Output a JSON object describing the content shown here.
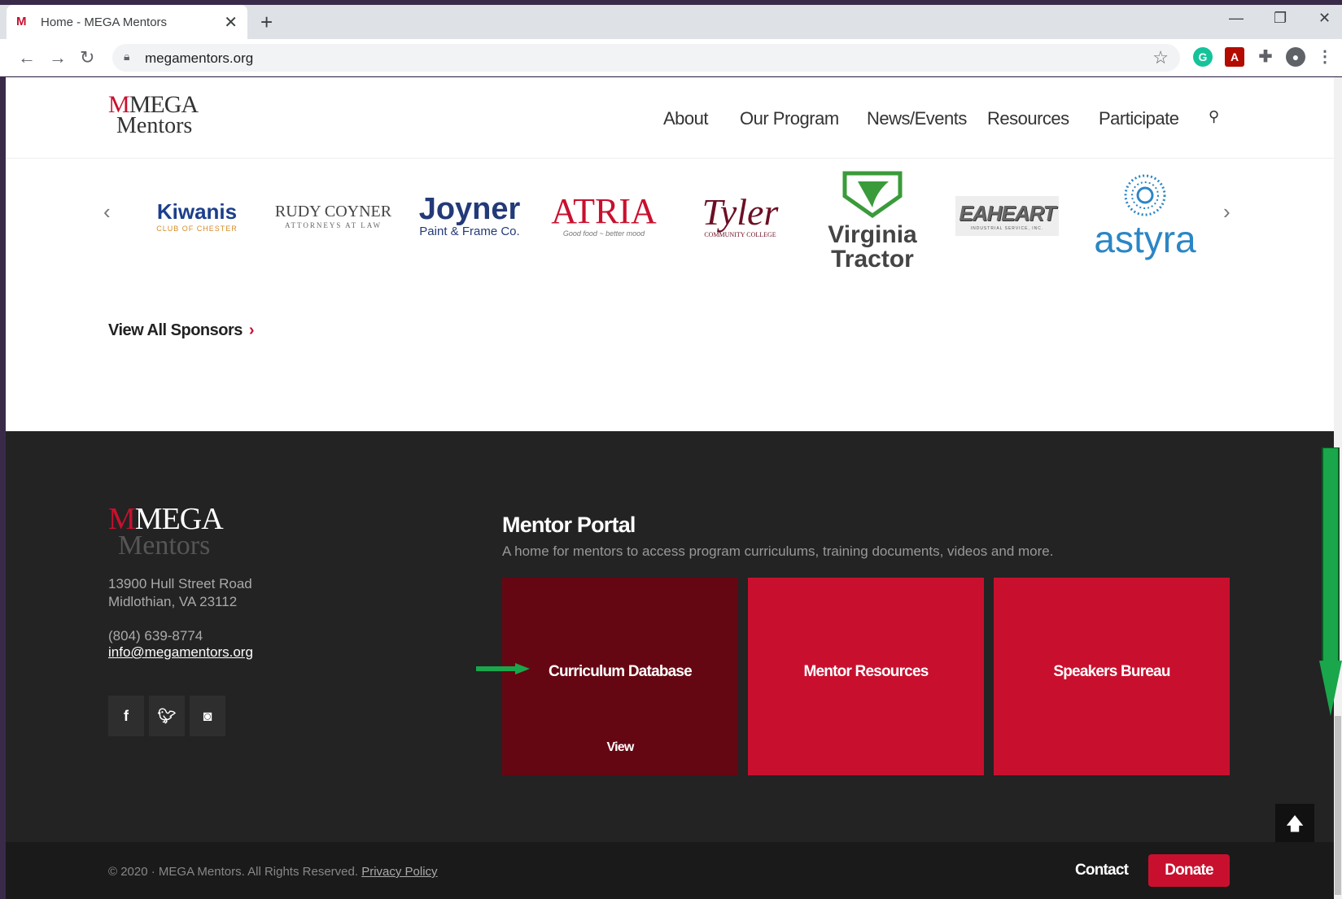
{
  "browser": {
    "tab_title": "Home - MEGA Mentors",
    "new_tab": "+",
    "url": "megamentors.org"
  },
  "header": {
    "logo_top": "MEGA",
    "logo_bottom": "Mentors",
    "nav": [
      "About",
      "Our Program",
      "News/Events",
      "Resources",
      "Participate"
    ]
  },
  "sponsors": {
    "items": [
      {
        "name": "Kiwanis",
        "sub": "CLUB OF CHESTER"
      },
      {
        "name": "RUDY COYNER",
        "sub": "ATTORNEYS AT LAW"
      },
      {
        "name": "Joyner",
        "sub": "Paint & Frame Co."
      },
      {
        "name": "ATRIA",
        "sub": "Good food ~ better mood"
      },
      {
        "name": "Tyler",
        "sub": "COMMUNITY COLLEGE"
      },
      {
        "name": "Virginia",
        "sub": "Tractor"
      },
      {
        "name": "EAHEART",
        "sub": "INDUSTRIAL SERVICE, INC."
      },
      {
        "name": "astyra",
        "sub": ""
      }
    ],
    "view_all": "View All Sponsors"
  },
  "footer": {
    "address_line1": "13900 Hull Street Road",
    "address_line2": "Midlothian, VA 23112",
    "phone": "(804) 639-8774",
    "email": "info@megamentors.org",
    "portal_title": "Mentor Portal",
    "portal_desc": "A home for mentors to access program curriculums, training documents, videos and more.",
    "tiles": [
      {
        "title": "Curriculum Database",
        "action": "View"
      },
      {
        "title": "Mentor Resources"
      },
      {
        "title": "Speakers Bureau"
      }
    ],
    "copyright": "© 2020 · MEGA Mentors. All Rights Reserved.",
    "privacy": "Privacy Policy",
    "contact": "Contact",
    "donate": "Donate"
  },
  "colors": {
    "brand_red": "#c8102e",
    "dark_red": "#650712",
    "annotation_green": "#1aa64b"
  }
}
